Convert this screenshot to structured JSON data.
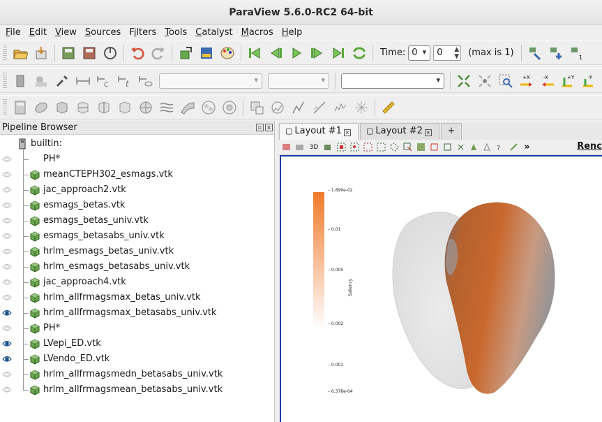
{
  "window": {
    "title": "ParaView 5.6.0-RC2 64-bit"
  },
  "menu": [
    "File",
    "Edit",
    "View",
    "Sources",
    "Filters",
    "Tools",
    "Catalyst",
    "Macros",
    "Help"
  ],
  "menu_mnemonics": [
    "F",
    "E",
    "V",
    "S",
    "i",
    "T",
    "C",
    "M",
    "H"
  ],
  "time": {
    "label": "Time:",
    "combo_value": "0",
    "spin_value": "0",
    "max_text": "(max is 1)"
  },
  "camera_buttons": [
    "+X",
    "-X",
    "+Y",
    "-Y"
  ],
  "pipeline": {
    "title": "Pipeline Browser",
    "root": "builtin:",
    "items": [
      {
        "label": "PH*",
        "visible": false,
        "icon": "none"
      },
      {
        "label": "meanCTEPH302_esmags.vtk",
        "visible": false,
        "icon": "cube"
      },
      {
        "label": "jac_approach2.vtk",
        "visible": false,
        "icon": "cube"
      },
      {
        "label": "esmags_betas.vtk",
        "visible": false,
        "icon": "cube"
      },
      {
        "label": "esmags_betas_univ.vtk",
        "visible": false,
        "icon": "cube"
      },
      {
        "label": "esmags_betasabs_univ.vtk",
        "visible": false,
        "icon": "cube"
      },
      {
        "label": "hrlm_esmags_betas_univ.vtk",
        "visible": false,
        "icon": "cube"
      },
      {
        "label": "hrlm_esmags_betasabs_univ.vtk",
        "visible": false,
        "icon": "cube"
      },
      {
        "label": "jac_approach4.vtk",
        "visible": false,
        "icon": "cube"
      },
      {
        "label": "hrlm_allfrmagsmax_betas_univ.vtk",
        "visible": false,
        "icon": "cube"
      },
      {
        "label": "hrlm_allfrmagsmax_betasabs_univ.vtk",
        "visible": true,
        "icon": "cube"
      },
      {
        "label": "PH*",
        "visible": false,
        "icon": "cube"
      },
      {
        "label": "LVepi_ED.vtk",
        "visible": true,
        "icon": "cube"
      },
      {
        "label": "LVendo_ED.vtk",
        "visible": true,
        "icon": "cube"
      },
      {
        "label": "hrlm_allfrmagsmedn_betasabs_univ.vtk",
        "visible": false,
        "icon": "cube"
      },
      {
        "label": "hrlm_allfrmagsmean_betasabs_univ.vtk",
        "visible": false,
        "icon": "cube"
      }
    ]
  },
  "layout_tabs": [
    {
      "label": "Layout #1",
      "active": true
    },
    {
      "label": "Layout #2",
      "active": false
    },
    {
      "label": "+",
      "active": false
    }
  ],
  "view_toolbar": {
    "mode_3d": "3D",
    "more": "»",
    "render_label": "Renc"
  },
  "colorbar": {
    "title": "Saliency",
    "ticks": [
      "1.899e-02",
      "0.01",
      "0.005",
      "0.002",
      "0.001",
      "6.378e-04"
    ],
    "color_max": "#f07a2a",
    "color_min": "#ffffff"
  },
  "colors": {
    "accent": "#1e3aa8",
    "mesh_orange": "#c8622a",
    "mesh_grey": "#e6e6e6"
  }
}
